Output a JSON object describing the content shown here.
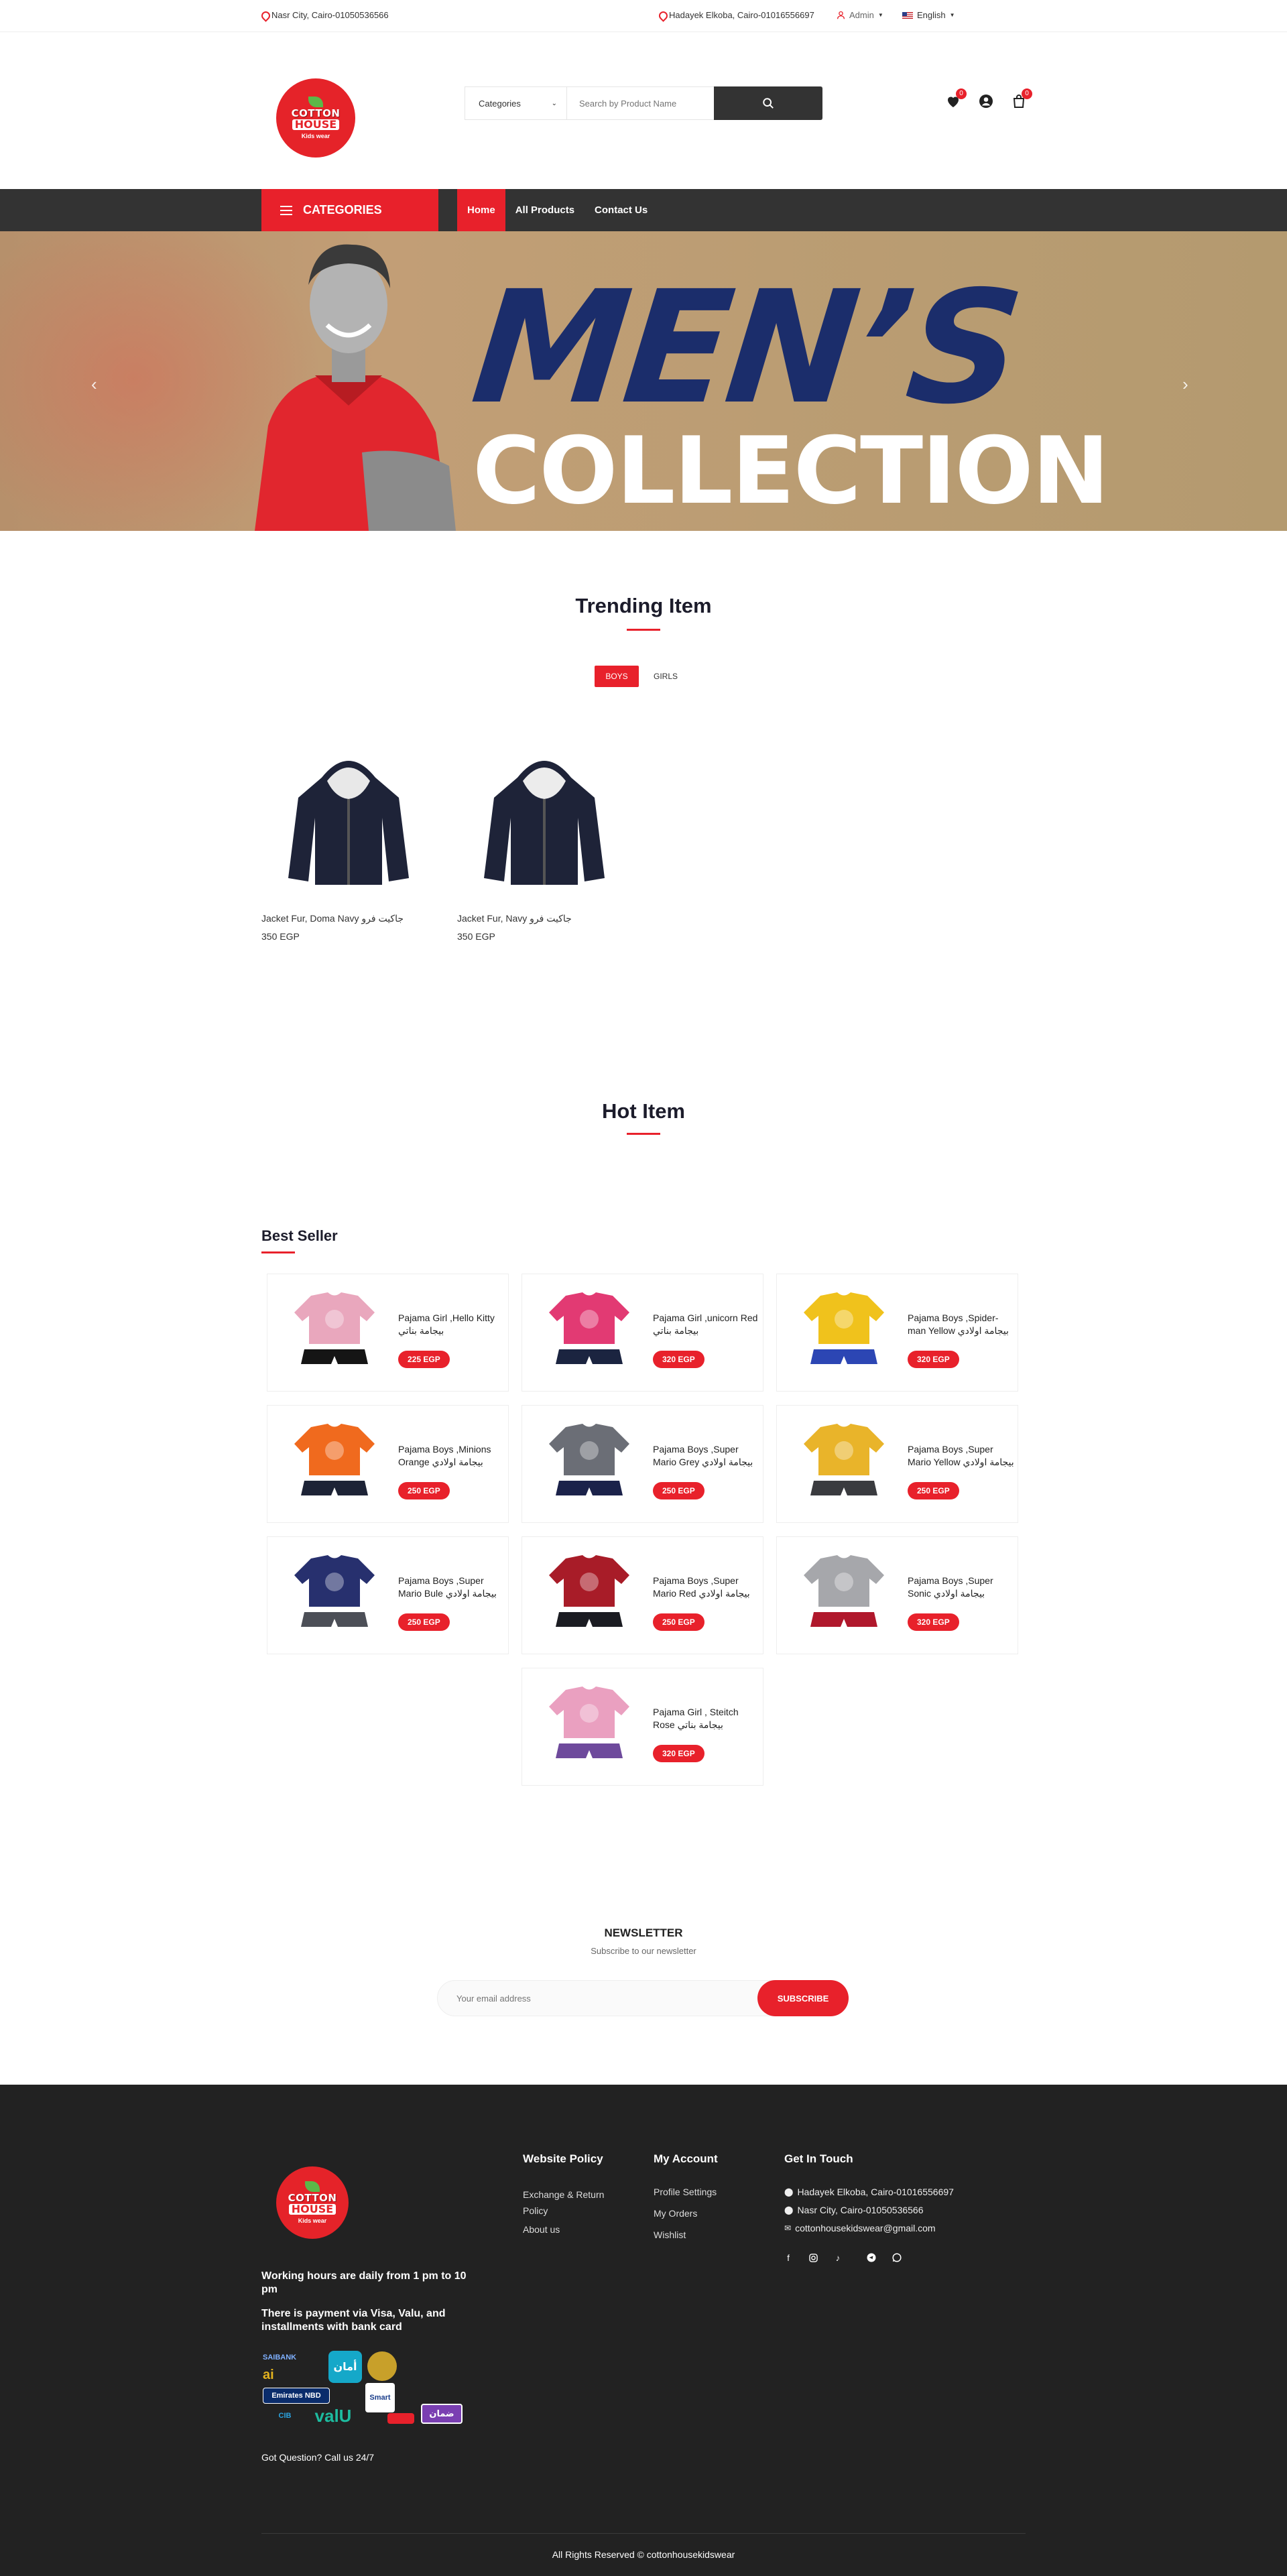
{
  "topbar": {
    "left_address": "Nasr City, Cairo-01050536566",
    "right_address": "Hadayek Elkoba, Cairo-01016556697",
    "admin": "Admin",
    "language": "English"
  },
  "header": {
    "logo_line1": "COTTON",
    "logo_line2": "HOUSE",
    "logo_line3": "Kids wear",
    "categories_label": "Categories",
    "search_placeholder": "Search by Product Name",
    "wishlist_count": "0",
    "cart_count": "0"
  },
  "nav": {
    "categories_label": "CATEGORIES",
    "items": [
      "Home",
      "All Products",
      "Contact Us"
    ]
  },
  "hero": {
    "line1": "MEN’S",
    "line2": "COLLECTION"
  },
  "trending": {
    "title": "Trending Item",
    "tabs": [
      "BOYS",
      "GIRLS"
    ],
    "products": [
      {
        "name": "Jacket Fur, Doma Navy جاكيت فرو",
        "price": "350 EGP"
      },
      {
        "name": "Jacket Fur, Navy جاكيت فرو",
        "price": "350 EGP"
      }
    ]
  },
  "hot": {
    "title": "Hot Item"
  },
  "best_seller": {
    "title": "Best Seller",
    "items": [
      {
        "name": "Pajama Girl ,Hello Kitty بيجامة بناتي",
        "price": "225 EGP",
        "top": "#e9a7bd",
        "bottom": "#151515"
      },
      {
        "name": "Pajama Girl ,unicorn Red بيجامة بناتي",
        "price": "320 EGP",
        "top": "#e23a73",
        "bottom": "#1b2440"
      },
      {
        "name": "Pajama Boys ,Spider-man Yellow بيجامة اولادي",
        "price": "320 EGP",
        "top": "#f0c21c",
        "bottom": "#2c46b4"
      },
      {
        "name": "Pajama Boys ,Minions Orange بيجامة اولادي",
        "price": "250 EGP",
        "top": "#f06a1e",
        "bottom": "#1d2336"
      },
      {
        "name": "Pajama Boys ,Super Mario Grey بيجامة اولادي",
        "price": "250 EGP",
        "top": "#6b6e76",
        "bottom": "#1b224a"
      },
      {
        "name": "Pajama Boys ,Super Mario Yellow بيجامة اولادي",
        "price": "250 EGP",
        "top": "#e9b42a",
        "bottom": "#3a3b3f"
      },
      {
        "name": "Pajama Boys ,Super Mario Bule بيجامة اولادي",
        "price": "250 EGP",
        "top": "#27306e",
        "bottom": "#4c4f57"
      },
      {
        "name": "Pajama Boys ,Super Mario Red بيجامة اولادي",
        "price": "250 EGP",
        "top": "#a81c28",
        "bottom": "#1b1c22"
      },
      {
        "name": "Pajama Boys ,Super Sonic بيجامة اولادي",
        "price": "320 EGP",
        "top": "#a6a7ab",
        "bottom": "#b0182c"
      },
      {
        "name": "Pajama Girl , Steitch Rose بيجامة بناتي",
        "price": "320 EGP",
        "top": "#eaa0c0",
        "bottom": "#6e4a9c"
      }
    ]
  },
  "newsletter": {
    "title": "NEWSLETTER",
    "subtitle": "Subscribe to our newsletter",
    "placeholder": "Your email address",
    "button": "SUBSCRIBE"
  },
  "footer": {
    "hours": "Working hours are daily from 1 pm to 10 pm",
    "payment": "There is payment via Visa, Valu, and installments with bank card",
    "question": "Got Question? Call us 24/7",
    "policy_title": "Website Policy",
    "policy_links": [
      "Exchange & Return Policy",
      "About us"
    ],
    "account_title": "My Account",
    "account_links": [
      "Profile Settings",
      "My Orders",
      "Wishlist"
    ],
    "contact_title": "Get In Touch",
    "contact_lines": [
      "Hadayek Elkoba, Cairo-01016556697",
      "Nasr City, Cairo-01050536566",
      "cottonhousekidswear@gmail.com"
    ],
    "payment_logos": [
      "SAIBANK",
      "ai",
      "أمان",
      "Emirates NBD",
      "Smart",
      "valU",
      "ضمان",
      "CIB"
    ],
    "copyright": "All Rights Reserved © cottonhousekidswear"
  }
}
